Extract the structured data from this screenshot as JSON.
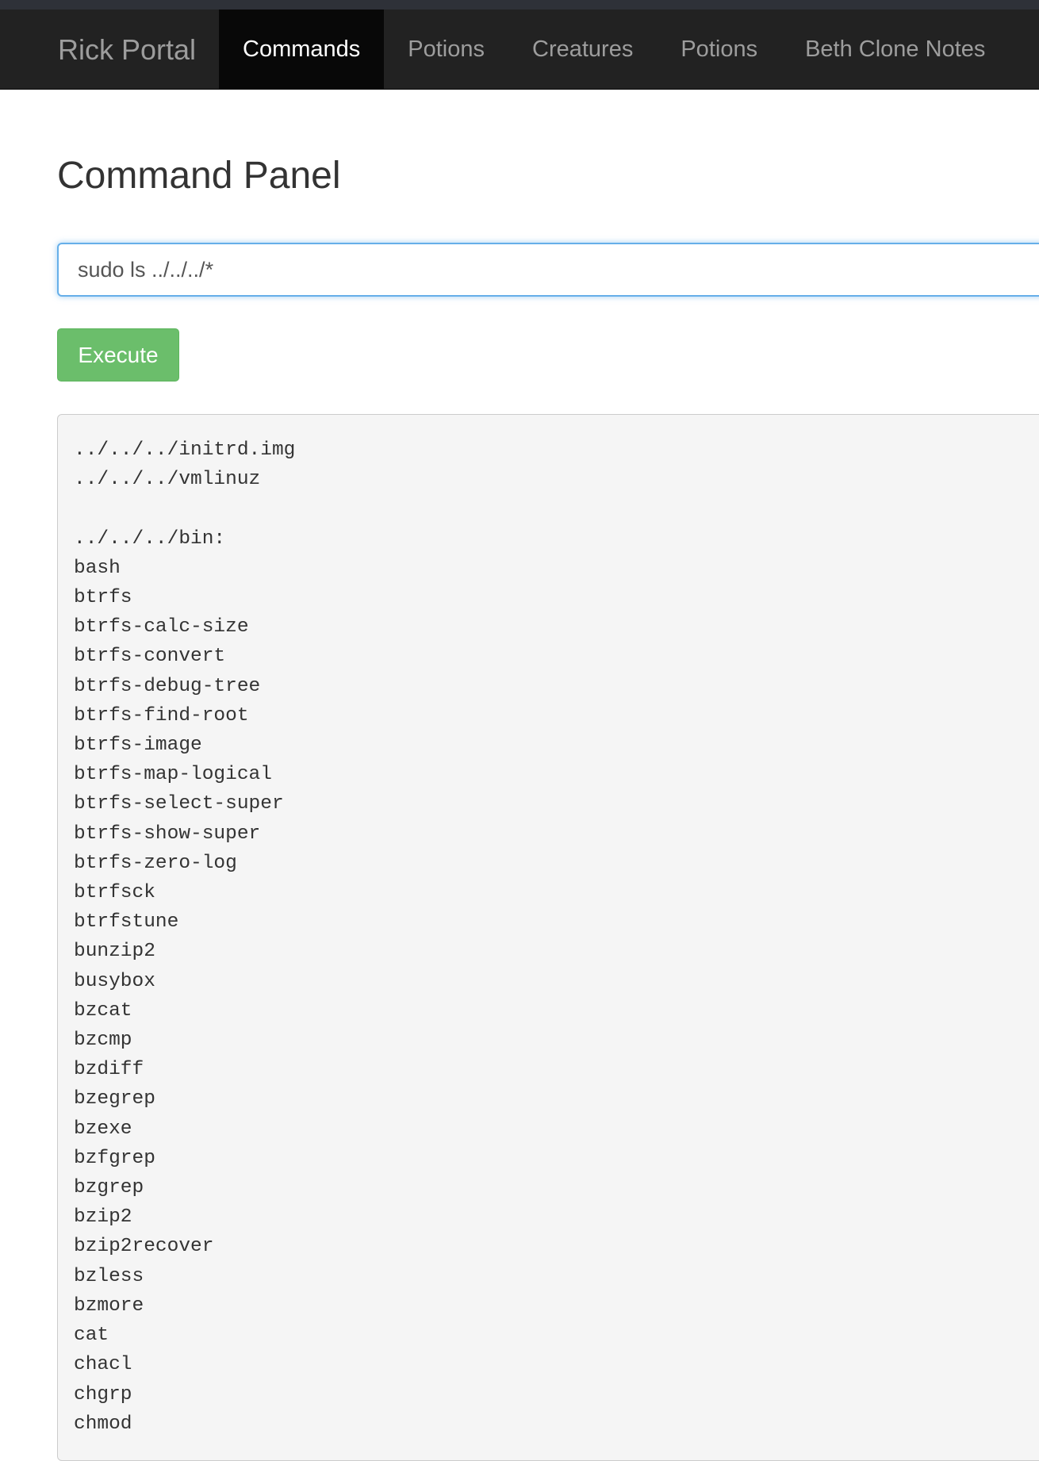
{
  "app": {
    "brand": "Rick Portal"
  },
  "nav": {
    "items": [
      {
        "label": "Commands",
        "active": true
      },
      {
        "label": "Potions",
        "active": false
      },
      {
        "label": "Creatures",
        "active": false
      },
      {
        "label": "Potions",
        "active": false
      },
      {
        "label": "Beth Clone Notes",
        "active": false
      }
    ]
  },
  "page": {
    "title": "Command Panel"
  },
  "command": {
    "value": "sudo ls ../../../*",
    "execute_label": "Execute"
  },
  "output": {
    "text": "../../../initrd.img\n../../../vmlinuz\n\n../../../bin:\nbash\nbtrfs\nbtrfs-calc-size\nbtrfs-convert\nbtrfs-debug-tree\nbtrfs-find-root\nbtrfs-image\nbtrfs-map-logical\nbtrfs-select-super\nbtrfs-show-super\nbtrfs-zero-log\nbtrfsck\nbtrfstune\nbunzip2\nbusybox\nbzcat\nbzcmp\nbzdiff\nbzegrep\nbzexe\nbzfgrep\nbzgrep\nbzip2\nbzip2recover\nbzless\nbzmore\ncat\nchacl\nchgrp\nchmod"
  },
  "colors": {
    "navbar_bg": "#222222",
    "nav_active_bg": "#080808",
    "execute_button": "#5cb85c",
    "input_focus_border": "#66afe9",
    "output_bg": "#f5f5f5"
  }
}
